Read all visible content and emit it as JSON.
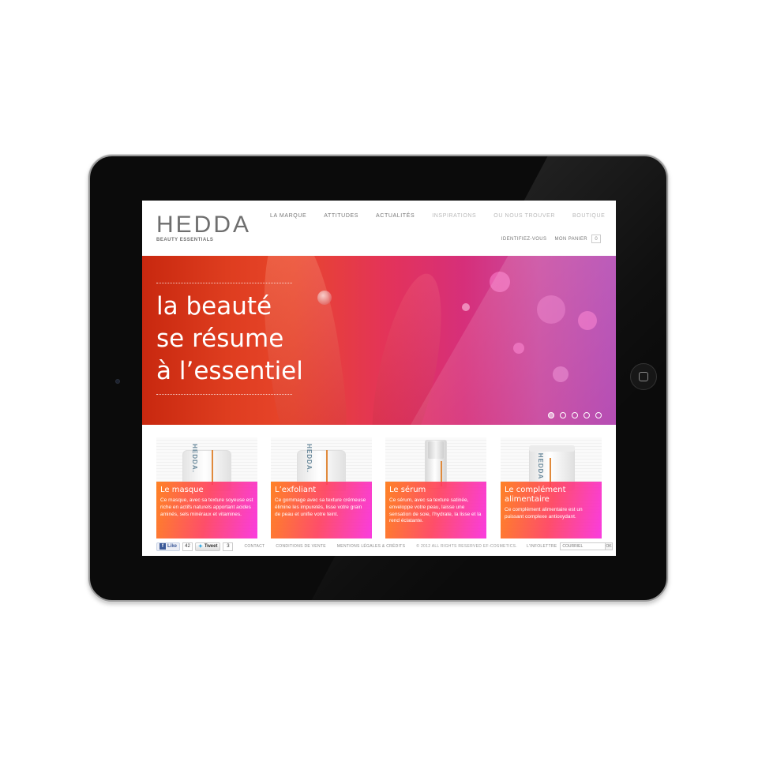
{
  "brand": {
    "name": "HEDDA",
    "tagline": "BEAUTY ESSENTIALS"
  },
  "nav": {
    "items": [
      {
        "label": "LA MARQUE"
      },
      {
        "label": "ATTITUDES"
      },
      {
        "label": "ACTUALITÉS"
      },
      {
        "label": "INSPIRATIONS"
      },
      {
        "label": "OU NOUS TROUVER"
      },
      {
        "label": "BOUTIQUE"
      }
    ]
  },
  "account": {
    "login_label": "IDENTIFIEZ-VOUS",
    "cart_label": "MON PANIER",
    "cart_count": "0"
  },
  "hero": {
    "line1": "la beauté",
    "line2": "se résume",
    "line3": "à l’essentiel",
    "slides_total": 5,
    "slide_active": 1
  },
  "products": [
    {
      "title": "Le masque",
      "description": "Ce masque, avec sa texture soyeuse est riche en actifs naturels apportant acides aminés, sels minéraux et vitamines.",
      "label": "HEDDA."
    },
    {
      "title": "L’exfoliant",
      "description": "Ce gommage avec sa texture crémeuse élimine les impuretés, lisse votre grain de peau et unifie votre teint.",
      "label": "HEDDA."
    },
    {
      "title": "Le sérum",
      "description": "Ce sérum, avec sa texture satinée, enveloppe votre peau, laisse une sensation de soie, l’hydrate, la lisse et la rend éclatante.",
      "label": ""
    },
    {
      "title": "Le complément alimentaire",
      "description": "Ce complément alimentaire est un puissant complexe antioxydant.",
      "label": "HEDDA"
    }
  ],
  "footer": {
    "like_label": "Like",
    "like_count": "42",
    "tweet_label": "Tweet",
    "tweet_count": "3",
    "contact": "CONTACT",
    "terms": "CONDITIONS DE VENTE",
    "legal": "MENTIONS LÉGALES & CRÉDITS",
    "copyright": "© 2012 ALL RIGHTS RESERVED EF-COSMETICS.",
    "newsletter_label": "L'INFOLETTRE",
    "newsletter_placeholder": "COURRIEL",
    "ok_label": "OK"
  },
  "colors": {
    "hero_start": "#c8280f",
    "hero_end": "#b44cb4",
    "card_overlay_start": "#ff7814",
    "card_overlay_end": "#fa28dc"
  }
}
